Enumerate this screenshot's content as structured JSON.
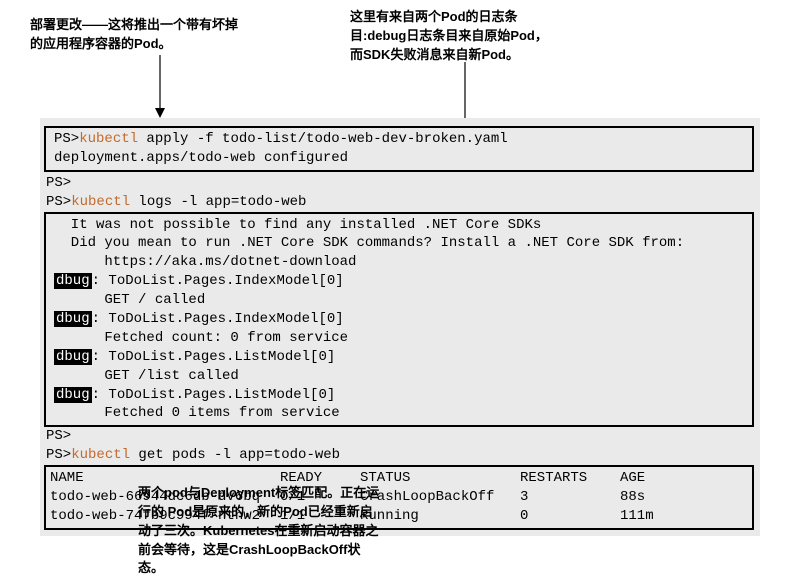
{
  "annotations": {
    "top_left": "部署更改——这将推出一个带有坏掉\n的应用程序容器的Pod。",
    "top_right": "这里有来自两个Pod的日志条\n目:debug日志条目来自原始Pod，\n而SDK失败消息来自新Pod。",
    "bottom": "两个pod与Deployment标签匹配。正在运\n行的 Pod是原来的，新的Pod已经重新启\n动了三次。Kubernetes在重新启动容器之\n前会等待，这是CrashLoopBackOff状\n态。"
  },
  "terminal": {
    "block1": {
      "line1_prompt": "PS>",
      "line1_cmd": "kubectl",
      "line1_rest": " apply -f todo-list/todo-web-dev-broken.yaml",
      "line2": "deployment.apps/todo-web configured"
    },
    "ps_blank1": "PS>",
    "cmd2_prompt": "PS>",
    "cmd2_cmd": "kubectl",
    "cmd2_rest": " logs -l app=todo-web",
    "logs": {
      "l1": "  It was not possible to find any installed .NET Core SDKs",
      "l2": "  Did you mean to run .NET Core SDK commands? Install a .NET Core SDK from:",
      "l3": "      https://aka.ms/dotnet-download",
      "d1_label": "dbug",
      "d1_rest": ": ToDoList.Pages.IndexModel[0]",
      "d1_sub": "      GET / called",
      "d2_label": "dbug",
      "d2_rest": ": ToDoList.Pages.IndexModel[0]",
      "d2_sub": "      Fetched count: 0 from service",
      "d3_label": "dbug",
      "d3_rest": ": ToDoList.Pages.ListModel[0]",
      "d3_sub": "      GET /list called",
      "d4_label": "dbug",
      "d4_rest": ": ToDoList.Pages.ListModel[0]",
      "d4_sub": "      Fetched 0 items from service"
    },
    "ps_blank2": "PS>",
    "cmd3_prompt": "PS>",
    "cmd3_cmd": "kubectl",
    "cmd3_rest": " get pods -l app=todo-web",
    "table": {
      "head": {
        "name": "NAME",
        "ready": "READY",
        "status": "STATUS",
        "restarts": "RESTARTS",
        "age": "AGE"
      },
      "row1": {
        "name": "todo-web-66944dc6db-dv6bq",
        "ready": "0/1",
        "status": "CrashLoopBackOff",
        "restarts": "3",
        "age": "88s"
      },
      "row2": {
        "name": "todo-web-74fb9c994f-ntnw2",
        "ready": "1/1",
        "status": "Running",
        "restarts": "0",
        "age": "111m"
      }
    }
  }
}
